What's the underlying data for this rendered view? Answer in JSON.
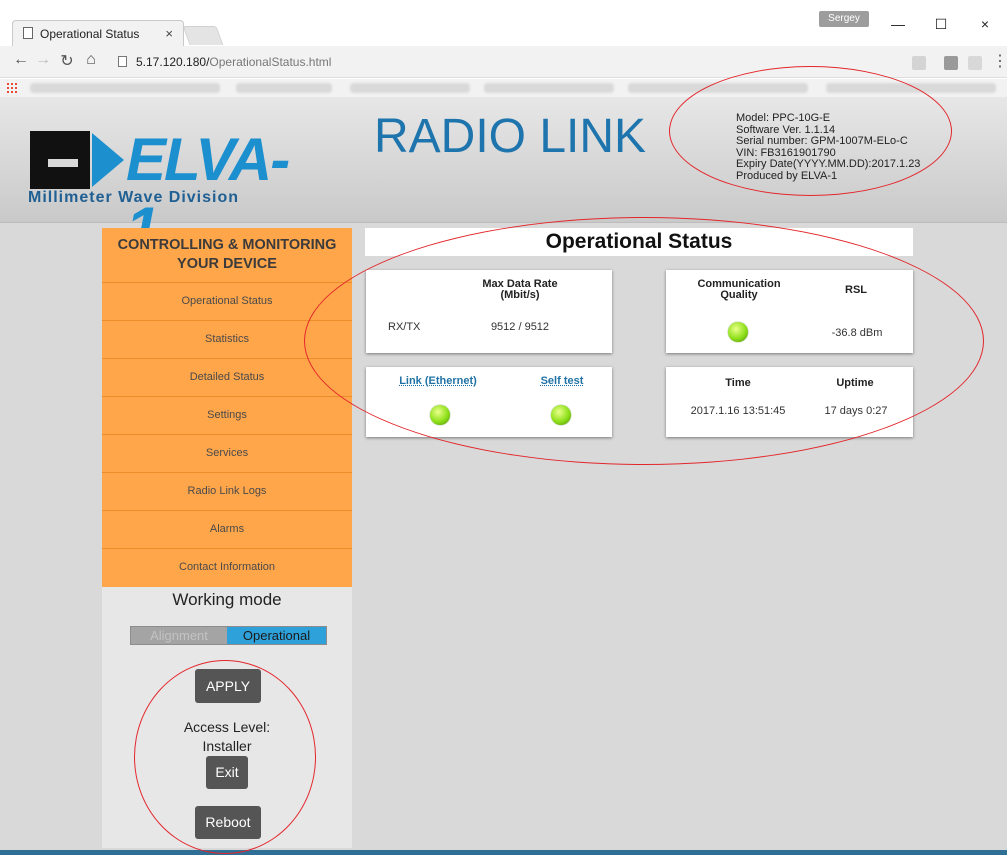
{
  "browser": {
    "tab_title": "Operational Status",
    "tab_close": "×",
    "user_badge": "Sergey",
    "minimize": "—",
    "maximize": "☐",
    "close": "×",
    "url_host": "5.17.120.180/",
    "url_path": "OperationalStatus.html"
  },
  "header": {
    "logo_word": "ELVA-1",
    "logo_sub": "Millimeter Wave Division",
    "title": "RADIO LINK",
    "device_info": [
      "Model: PPC-10G-E",
      "Software Ver. 1.1.14",
      "Serial number: GPM-1007M-ELo-C",
      "VIN: FB3161901790",
      "Expiry Date(YYYY.MM.DD):2017.1.23",
      "Produced by ELVA-1"
    ]
  },
  "sidebar": {
    "heading_line1": "CONTROLLING & MONITORING",
    "heading_line2": "YOUR DEVICE",
    "items": [
      "Operational Status",
      "Statistics",
      "Detailed Status",
      "Settings",
      "Services",
      "Radio Link Logs",
      "Alarms",
      "Contact Information"
    ],
    "working_mode_title": "Working mode",
    "mode_alignment": "Alignment",
    "mode_operational": "Operational",
    "apply": "APPLY",
    "access_label": "Access Level:",
    "access_value": "Installer",
    "exit": "Exit",
    "reboot": "Reboot"
  },
  "status": {
    "title": "Operational Status",
    "data_rate_header_line1": "Max Data Rate",
    "data_rate_header_line2": "(Mbit/s)",
    "rxtx_label": "RX/TX",
    "rxtx_value": "9512 / 9512",
    "comm_quality_line1": "Communication",
    "comm_quality_line2": "Quality",
    "rsl_label": "RSL",
    "rsl_value": "-36.8 dBm",
    "link_label": "Link (Ethernet)",
    "selftest_label": "Self test",
    "time_label": "Time",
    "time_value": "2017.1.16 13:51:45",
    "uptime_label": "Uptime",
    "uptime_value": "17 days 0:27"
  },
  "colors": {
    "menu_orange": "#ffa64a",
    "brand_blue": "#1c8fcf",
    "led_green": "#8ee01a",
    "annotation_red": "#e3262b"
  }
}
